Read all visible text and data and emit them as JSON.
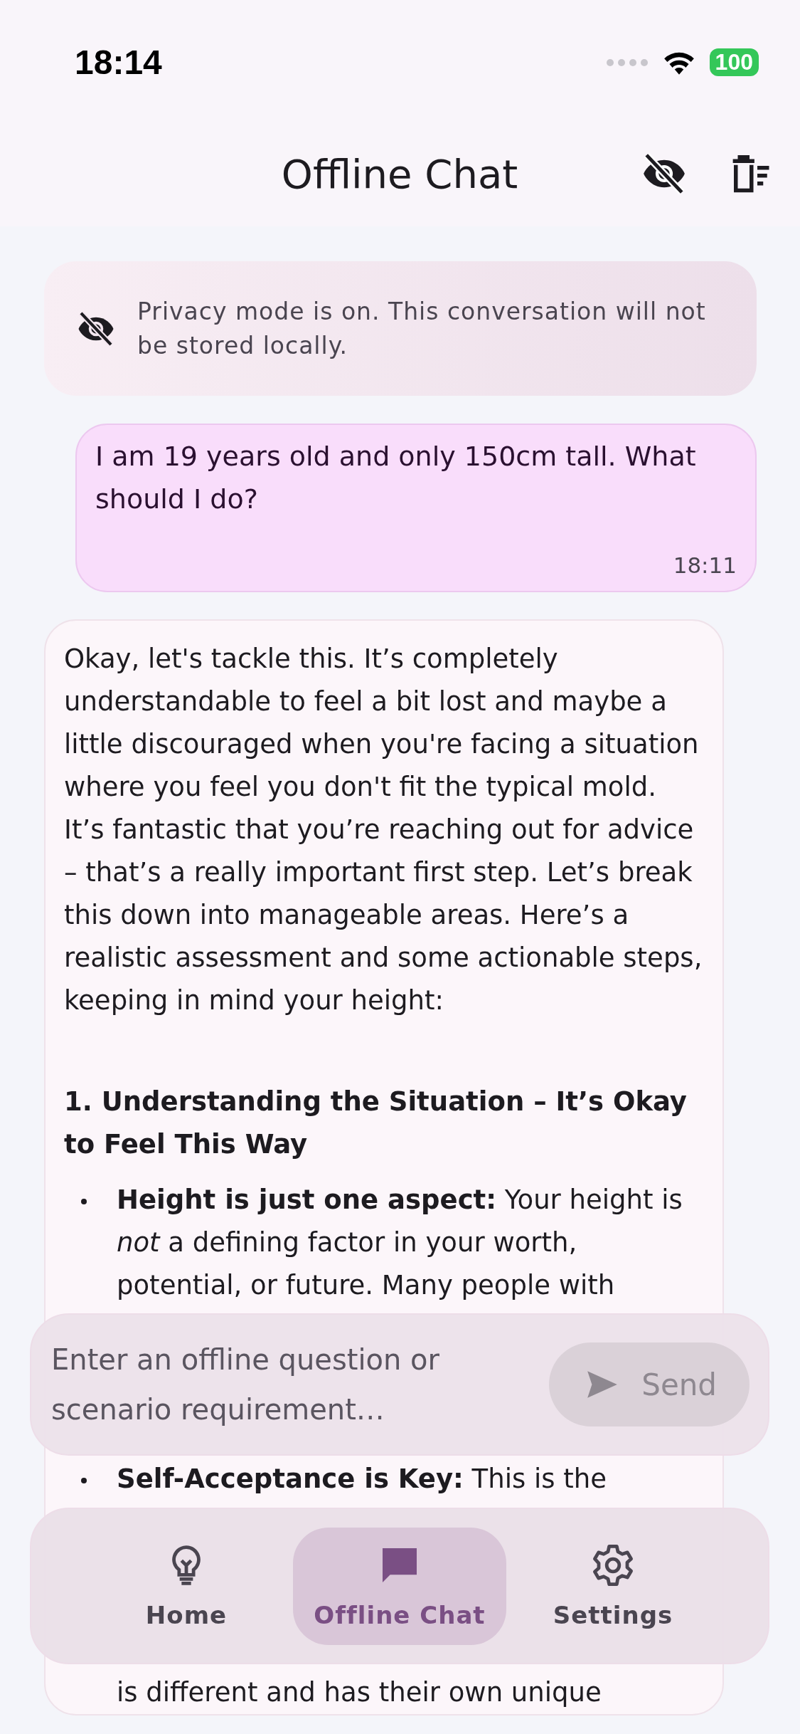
{
  "status_bar": {
    "time": "18:14",
    "battery": "100"
  },
  "header": {
    "title": "Offline Chat"
  },
  "privacy_banner": {
    "text": "Privacy mode is on. This conversation will not be stored locally."
  },
  "messages": [
    {
      "kind": "user",
      "text": "I am 19 years old and only 150cm tall. What should I do?",
      "time": "18:11"
    },
    {
      "kind": "assistant",
      "blocks": [
        {
          "kind": "paragraph",
          "text": "Okay, let's tackle this. It’s completely understandable to feel a bit lost and maybe a little discouraged when you're facing a situation where you feel you don't fit the typical mold. It’s fantastic that you’re reaching out for advice – that’s a really important first step. Let’s break this down into manageable areas.  Here’s a realistic assessment and some actionable steps, keeping in mind your height:"
        },
        {
          "kind": "heading",
          "text": "1. Understanding the Situation – It’s Okay to Feel This Way"
        },
        {
          "kind": "bullet",
          "text": "**Height is just one aspect:**  Your height is *not* a defining factor in your worth, potential, or future.  Many people with"
        },
        {
          "kind": "bullet",
          "text": "**Self-Acceptance is Key:** This is the"
        },
        {
          "kind": "continuation",
          "text": "is different and has their own unique"
        }
      ]
    }
  ],
  "composer": {
    "placeholder": "Enter an offline question or scenario requirement…",
    "send_label": "Send",
    "send_disabled": true
  },
  "nav": [
    {
      "label": "Home",
      "kind": "bulb",
      "selected": false
    },
    {
      "label": "Offline Chat",
      "kind": "chat",
      "selected": true
    },
    {
      "label": "Settings",
      "kind": "gear",
      "selected": false
    }
  ]
}
